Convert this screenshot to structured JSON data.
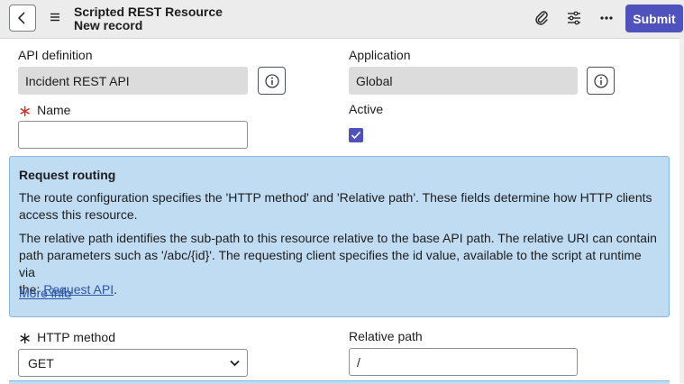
{
  "header": {
    "title": "Scripted REST Resource",
    "subtitle": "New record",
    "submit_label": "Submit",
    "icons": [
      "chevron-left-icon",
      "hamburger-menu-icon",
      "paperclip-icon",
      "sliders-icon",
      "more-options-icon"
    ]
  },
  "form": {
    "api_definition": {
      "label": "API definition",
      "value": "Incident REST API"
    },
    "application": {
      "label": "Application",
      "value": "Global"
    },
    "name": {
      "label": "Name",
      "value": "",
      "required": true
    },
    "active": {
      "label": "Active",
      "checked": true
    },
    "http_method": {
      "label": "HTTP method",
      "value": "GET"
    },
    "relative_path": {
      "label": "Relative path",
      "value": "/"
    }
  },
  "info_panel": {
    "title": "Request routing",
    "paragraph1": "The route configuration specifies the 'HTTP method' and 'Relative path'. These fields determine how HTTP clients access this resource.",
    "paragraph2_line1": "The relative path identifies the sub-path to this resource relative to the base API path. The relative URI can contain",
    "paragraph2_line2": "path parameters such as '/abc/{id}'. The requesting client specifies the id value, available to the script at runtime via",
    "paragraph2_prefix": "the: ",
    "paragraph2_link": "Request API",
    "paragraph2_suffix": ".",
    "more_info": "More info"
  },
  "colors": {
    "accent": "#4f52bd",
    "panel_background": "#bfdcf2",
    "required_star": "#d93025",
    "link": "#2d54a7"
  }
}
